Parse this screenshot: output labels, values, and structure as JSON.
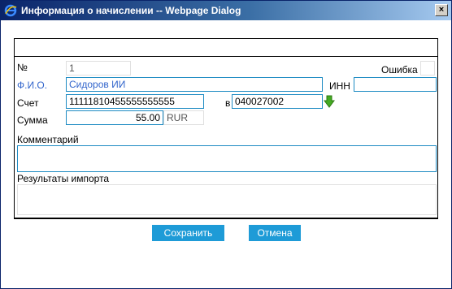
{
  "window": {
    "title": "Информация о начислении -- Webpage Dialog",
    "close_glyph": "×"
  },
  "form": {
    "number_label": "№",
    "number_value": "1",
    "error_label": "Ошибка",
    "fio_label": "Ф.И.О.",
    "fio_value": "Сидоров ИИ",
    "inn_label": "ИНН",
    "inn_value": "",
    "account_label": "Счет",
    "account_value": "11111810455555555555",
    "bank_label": "в",
    "bank_value": "040027002",
    "sum_label": "Сумма",
    "sum_value": "55.00",
    "currency_value": "RUR",
    "comment_label": "Комментарий",
    "comment_value": "",
    "import_results_label": "Результаты импорта",
    "import_results_value": ""
  },
  "buttons": {
    "save_label": "Сохранить",
    "cancel_label": "Отмена"
  },
  "colors": {
    "accent": "#1e9bd7",
    "field_border": "#1e8bc3",
    "label_link": "#3366cc",
    "arrow_icon": "#44aa22"
  },
  "icons": {
    "title_icon": "ie-icon",
    "arrow_icon": "arrow-down-icon"
  }
}
